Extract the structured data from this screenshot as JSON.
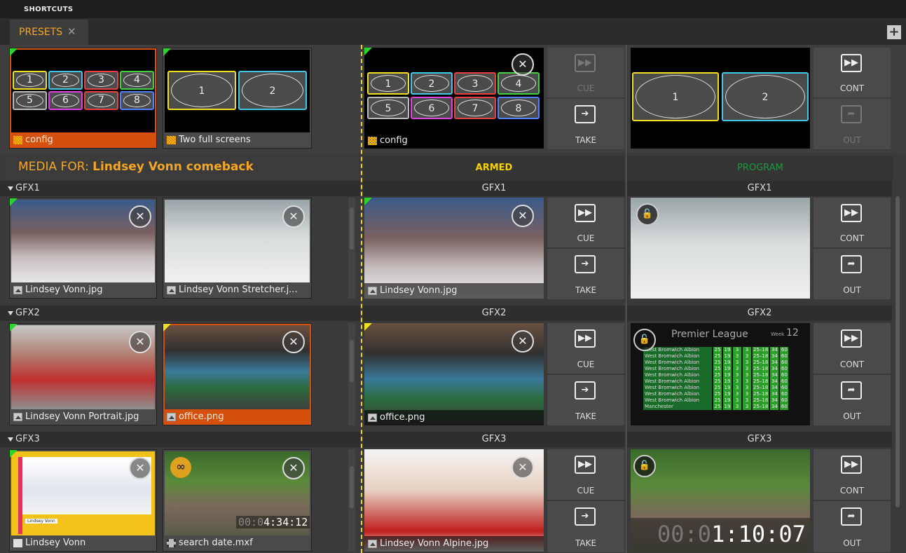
{
  "shortcuts_label": "SHORTCUTS",
  "tabs": [
    {
      "label": "PRESETS",
      "close": "✕"
    }
  ],
  "add_tab": "+",
  "presets": [
    {
      "label": "config",
      "cells": [
        "1",
        "2",
        "3",
        "4",
        "5",
        "6",
        "7",
        "8"
      ]
    },
    {
      "label": "Two full screens",
      "cells": [
        "1",
        "2"
      ]
    }
  ],
  "preset_armed": {
    "label": "config",
    "cells": [
      "1",
      "2",
      "3",
      "4",
      "5",
      "6",
      "7",
      "8"
    ]
  },
  "preset_program": {
    "cells": [
      "1",
      "2"
    ]
  },
  "buttons": {
    "cue": "CUE",
    "take": "TAKE",
    "cont": "CONT",
    "out": "OUT"
  },
  "media_for": {
    "prefix": "MEDIA FOR:",
    "title": "Lindsey Vonn comeback"
  },
  "columns": {
    "armed": "ARMED",
    "program": "PROGRAM"
  },
  "colors": {
    "armed": "#f5d200",
    "program": "#1a9a3a",
    "accent": "#f5a623",
    "selected": "#d4500c"
  },
  "groups": [
    {
      "name": "GFX1",
      "media": [
        {
          "label": "Lindsey Vonn.jpg",
          "icon": "image-icon"
        },
        {
          "label": "Lindsey Vonn Stretcher.j...",
          "icon": "image-icon"
        }
      ],
      "armed": {
        "label": "Lindsey Vonn.jpg"
      },
      "program": {}
    },
    {
      "name": "GFX2",
      "media": [
        {
          "label": "Lindsey Vonn Portrait.jpg",
          "icon": "image-icon"
        },
        {
          "label": "office.png",
          "icon": "image-icon"
        }
      ],
      "armed": {
        "label": "office.png"
      },
      "program": {
        "league_title": "Premier League",
        "week_label": "Week",
        "week_num": "12",
        "row_team": "West Bromwich Albion",
        "last_team": "Manchester",
        "row_values": [
          "25",
          "19",
          "3",
          "3",
          "25–18",
          "34",
          "60"
        ]
      }
    },
    {
      "name": "GFX3",
      "media": [
        {
          "label": "Lindsey Vonn",
          "icon": "document-icon",
          "inner_name": "Lindsey Vonn"
        },
        {
          "label": "search date.mxf",
          "icon": "film-icon",
          "timecode_dim": "00:0",
          "timecode": "4:34:12"
        }
      ],
      "armed": {
        "label": "Lindsey Vonn Alpine.jpg"
      },
      "program": {
        "timecode_dim": "00:0",
        "timecode": "1:10:07"
      }
    }
  ]
}
